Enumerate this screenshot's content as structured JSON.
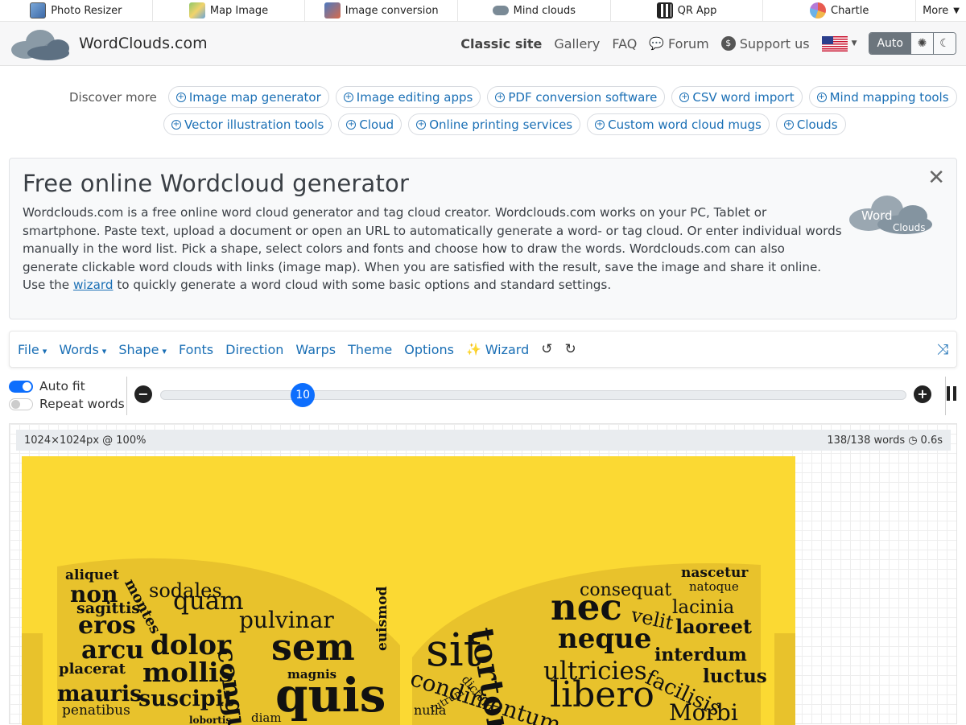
{
  "topbar": {
    "items": [
      {
        "label": "Photo Resizer",
        "icon": "photo-resizer-icon"
      },
      {
        "label": "Map Image",
        "icon": "map-image-icon"
      },
      {
        "label": "Image conversion",
        "icon": "image-conversion-icon"
      },
      {
        "label": "Mind clouds",
        "icon": "mind-clouds-icon"
      },
      {
        "label": "QR App",
        "icon": "qr-app-icon"
      },
      {
        "label": "Chartle",
        "icon": "chartle-icon"
      }
    ],
    "more_label": "More"
  },
  "header": {
    "logo_text": "WordClouds.com",
    "nav": {
      "classic": "Classic site",
      "gallery": "Gallery",
      "faq": "FAQ",
      "forum": "Forum",
      "support": "Support us"
    },
    "theme": {
      "auto": "Auto"
    }
  },
  "discover": {
    "label": "Discover more",
    "row1": [
      "Image map generator",
      "Image editing apps",
      "PDF conversion software",
      "CSV word import",
      "Mind mapping tools"
    ],
    "row2": [
      "Vector illustration tools",
      "Cloud",
      "Online printing services",
      "Custom word cloud mugs",
      "Clouds"
    ]
  },
  "intro": {
    "title": "Free online Wordcloud generator",
    "text_before_link": "Wordclouds.com is a free online word cloud generator and tag cloud creator. Wordclouds.com works on your PC, Tablet or smartphone. Paste text, upload a document or open an URL to automatically generate a word- or tag cloud. Or enter individual words manually in the word list. Pick a shape, select colors and fonts and choose how to draw the words. Wordclouds.com can also generate clickable word clouds with links (image map). When you are satisfied with the result, save the image and share it online. Use the ",
    "link_text": "wizard",
    "text_after_link": " to quickly generate a word cloud with some basic options and standard settings.",
    "logo_word": "Word",
    "logo_clouds": "Clouds"
  },
  "toolbar": {
    "file": "File",
    "words": "Words",
    "shape": "Shape",
    "fonts": "Fonts",
    "direction": "Direction",
    "warps": "Warps",
    "theme": "Theme",
    "options": "Options",
    "wizard": "Wizard"
  },
  "controls": {
    "auto_fit": "Auto fit",
    "repeat_words": "Repeat words",
    "slider_value": "10",
    "slider_fraction": 0.19
  },
  "canvas": {
    "size_info": "1024×1024px @ 100%",
    "word_count": "138/138 words",
    "time": "0.6s",
    "background": "#fbd933",
    "shape_color": "#e8c22c"
  },
  "wordcloud": {
    "words": [
      "aliquet",
      "non",
      "sodales",
      "sagittis",
      "montes",
      "quam",
      "eros",
      "pulvinar",
      "arcu",
      "dolor",
      "sem",
      "congue",
      "placerat",
      "mollis",
      "magnis",
      "quis",
      "euismod",
      "mauris",
      "suscipit",
      "penatibus",
      "diam",
      "lobortis",
      "sit",
      "tortor",
      "rutrum",
      "dictum",
      "nulla",
      "condimentum",
      "consequat",
      "nascetur",
      "natoque",
      "nec",
      "velit",
      "lacinia",
      "laoreet",
      "neque",
      "interdum",
      "ultricies",
      "luctus",
      "facilisis",
      "libero",
      "Morbi"
    ]
  },
  "colors": {
    "accent": "#0d6efd",
    "link": "#1a6fb5"
  }
}
